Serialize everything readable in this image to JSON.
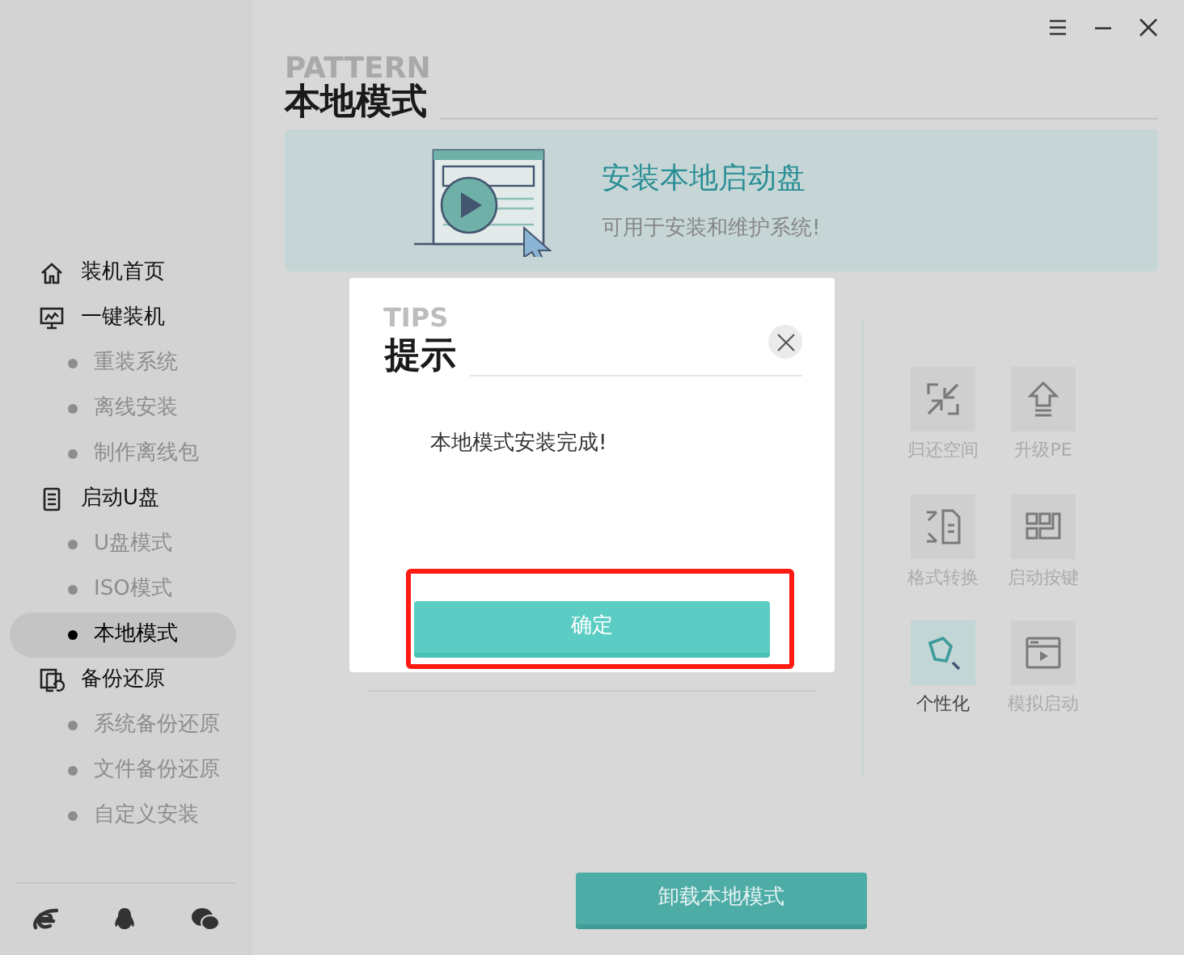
{
  "sidebar": {
    "sections": [
      {
        "label": "装机首页",
        "selected": false
      },
      {
        "label": "一键装机",
        "selected": false,
        "children": [
          {
            "label": "重装系统",
            "selected": false
          },
          {
            "label": "离线安装",
            "selected": false
          },
          {
            "label": "制作离线包",
            "selected": false
          }
        ]
      },
      {
        "label": "启动U盘",
        "selected": false,
        "children": [
          {
            "label": "U盘模式",
            "selected": false
          },
          {
            "label": "ISO模式",
            "selected": false
          },
          {
            "label": "本地模式",
            "selected": true
          }
        ]
      },
      {
        "label": "备份还原",
        "selected": false,
        "children": [
          {
            "label": "系统备份还原",
            "selected": false
          },
          {
            "label": "文件备份还原",
            "selected": false
          },
          {
            "label": "自定义安装",
            "selected": false
          }
        ]
      }
    ]
  },
  "header": {
    "ghost": "PATTERN",
    "title": "本地模式"
  },
  "banner": {
    "heading": "安装本地启动盘",
    "subtitle": "可用于安装和维护系统!"
  },
  "tools": [
    {
      "label": "归还空间",
      "selected": false
    },
    {
      "label": "升级PE",
      "selected": false
    },
    {
      "label": "格式转换",
      "selected": false
    },
    {
      "label": "启动按键",
      "selected": false
    },
    {
      "label": "个性化",
      "selected": true
    },
    {
      "label": "模拟启动",
      "selected": false
    }
  ],
  "uninstall_button": "卸载本地模式",
  "dialog": {
    "ghost": "TIPS",
    "title": "提示",
    "message": "本地模式安装完成!",
    "ok_button": {
      "label": "确定",
      "highlighted": true
    }
  }
}
